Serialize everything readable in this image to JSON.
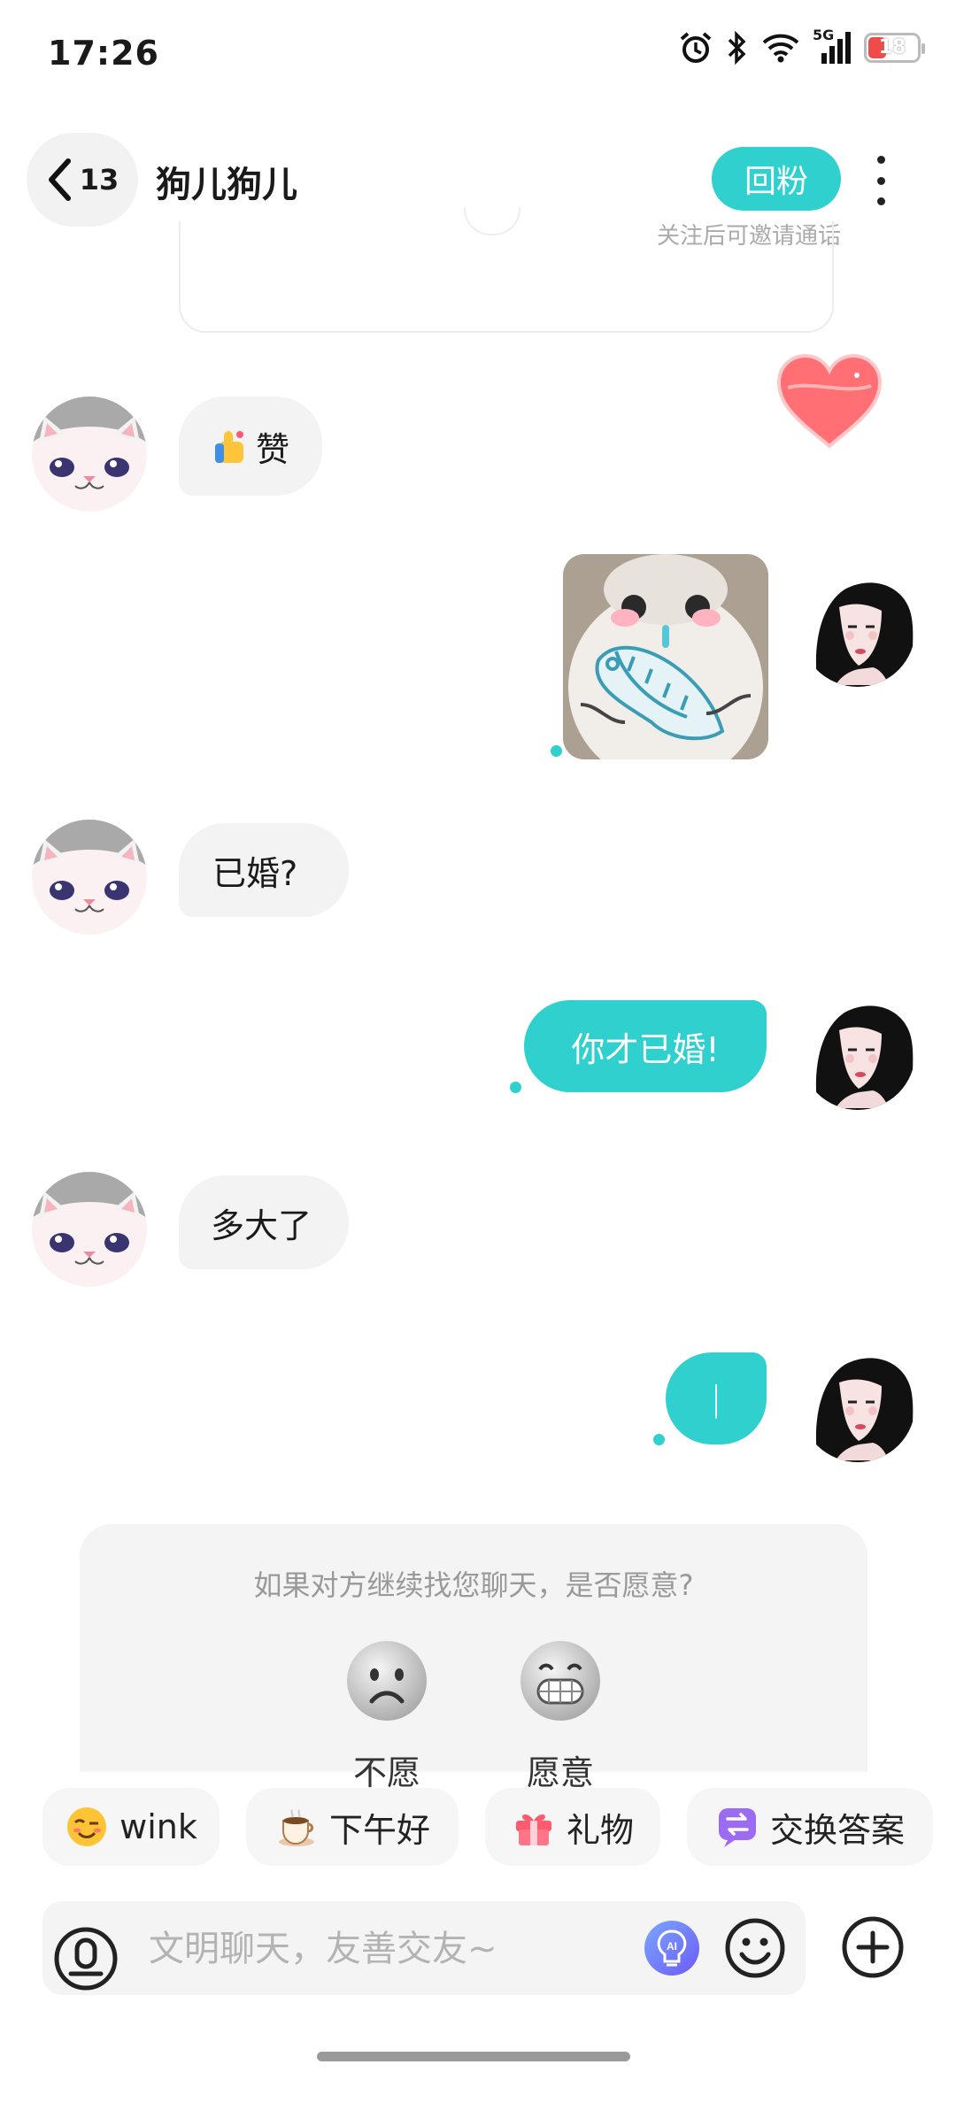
{
  "status_bar": {
    "time": "17:26",
    "network": "5G",
    "battery": "18"
  },
  "header": {
    "back_count": "13",
    "title": "狗儿狗儿",
    "follow_button": "回粉",
    "follow_hint": "关注后可邀请通话"
  },
  "messages": [
    {
      "side": "left",
      "type": "sticker-text",
      "text": "赞"
    },
    {
      "side": "right",
      "type": "image",
      "content": "crying-cat-holding-fish-sticker"
    },
    {
      "side": "left",
      "type": "text",
      "text": "已婚?"
    },
    {
      "side": "right",
      "type": "text",
      "text": "你才已婚!"
    },
    {
      "side": "left",
      "type": "text",
      "text": "多大了"
    },
    {
      "side": "right",
      "type": "text",
      "text": "|"
    }
  ],
  "survey": {
    "question": "如果对方继续找您聊天，是否愿意?",
    "options": [
      "不愿意",
      "愿意"
    ]
  },
  "quick_actions": [
    "wink",
    "下午好",
    "礼物",
    "交换答案"
  ],
  "input": {
    "placeholder": "文明聊天，友善交友~"
  },
  "colors": {
    "accent": "#2fd0cd",
    "heart": "#ff6f73",
    "gift_chip": "#ff5a6e",
    "exchange_chip": "#9b6cf2"
  }
}
